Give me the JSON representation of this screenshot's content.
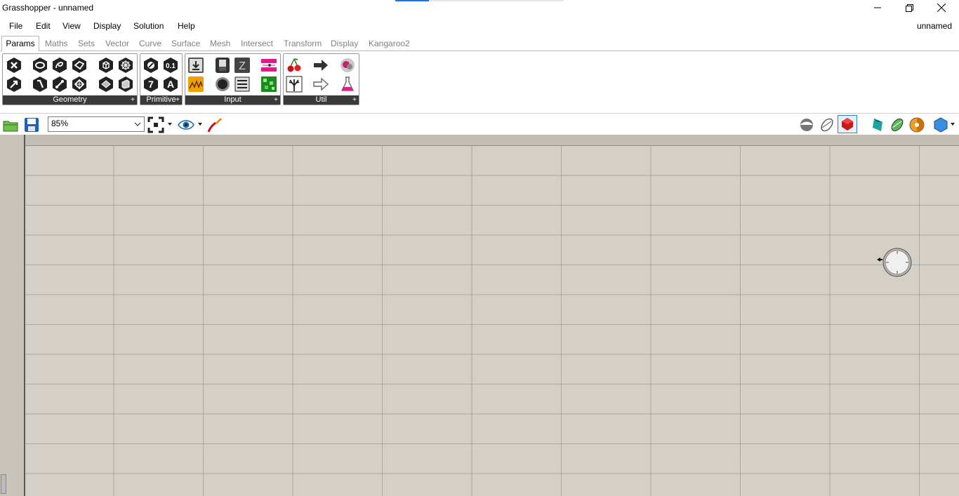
{
  "window": {
    "title": "Grasshopper - unnamed",
    "controls": [
      "minimize-icon",
      "restore-icon",
      "close-icon"
    ]
  },
  "menubar": {
    "items": [
      "File",
      "Edit",
      "View",
      "Display",
      "Solution",
      "Help"
    ],
    "document_name": "unnamed"
  },
  "tabs": {
    "active": "Params",
    "items": [
      "Params",
      "Maths",
      "Sets",
      "Vector",
      "Curve",
      "Surface",
      "Mesh",
      "Intersect",
      "Transform",
      "Display",
      "Kangaroo2"
    ]
  },
  "ribbon": {
    "panels": [
      {
        "label": "Geometry"
      },
      {
        "label": "Primitive"
      },
      {
        "label": "Input"
      },
      {
        "label": "Util"
      }
    ],
    "glyphs": {
      "number": "0.1",
      "integer": "7",
      "text": "A",
      "expand": "+"
    }
  },
  "toolbar": {
    "zoom_value": "85%",
    "colors": {
      "accent_selected": "#2f7dd3"
    }
  },
  "canvas": {
    "background": "#d4d0c8",
    "node": "param-node-icon"
  }
}
